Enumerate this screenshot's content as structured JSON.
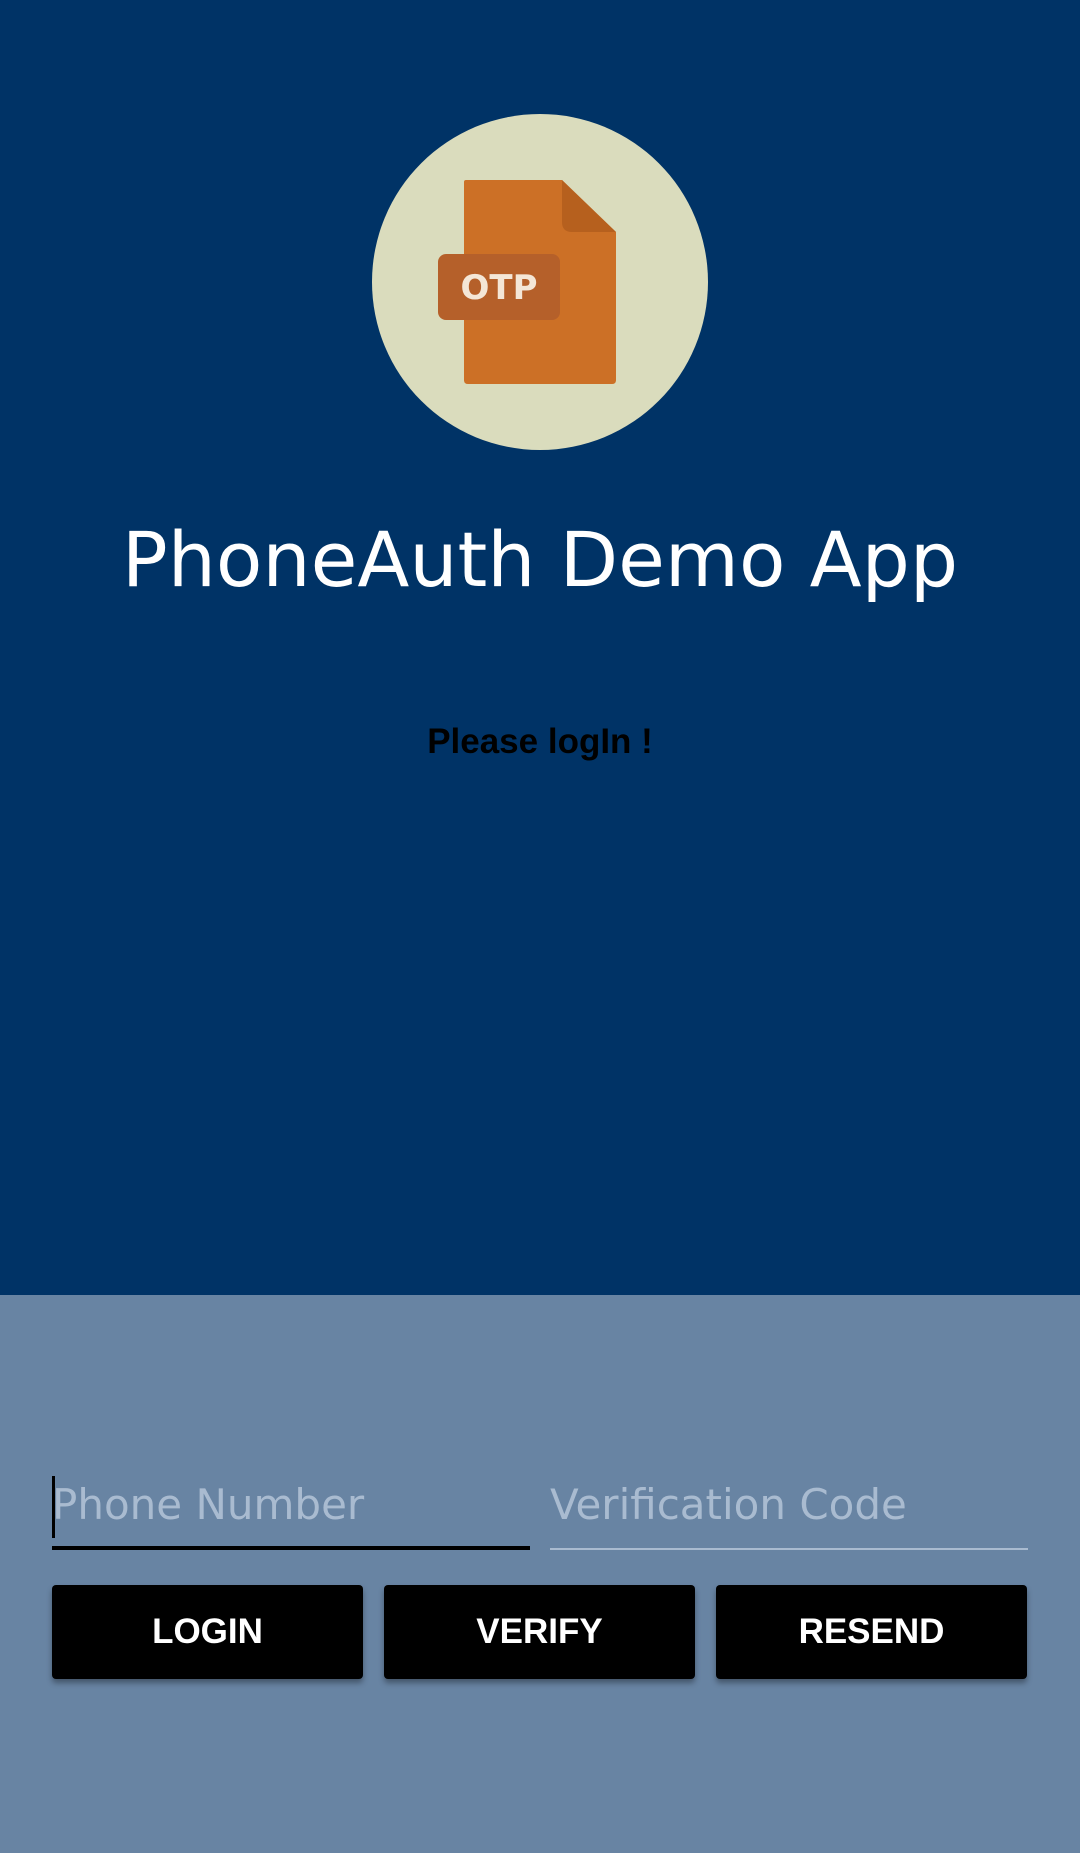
{
  "app": {
    "title": "PhoneAuth Demo App",
    "logo_icon": "otp-file-icon",
    "logo_text": "OTP",
    "status": "Please logIn !"
  },
  "form": {
    "phone_placeholder": "Phone Number",
    "phone_value": "",
    "code_placeholder": "Verification Code",
    "code_value": ""
  },
  "buttons": {
    "login": "LOGIN",
    "verify": "VERIFY",
    "resend": "RESEND"
  },
  "colors": {
    "top_background": "#003366",
    "bottom_background": "#6884a3",
    "logo_circle": "#dadcbd",
    "logo_file": "#cc7026",
    "button": "#000000"
  }
}
